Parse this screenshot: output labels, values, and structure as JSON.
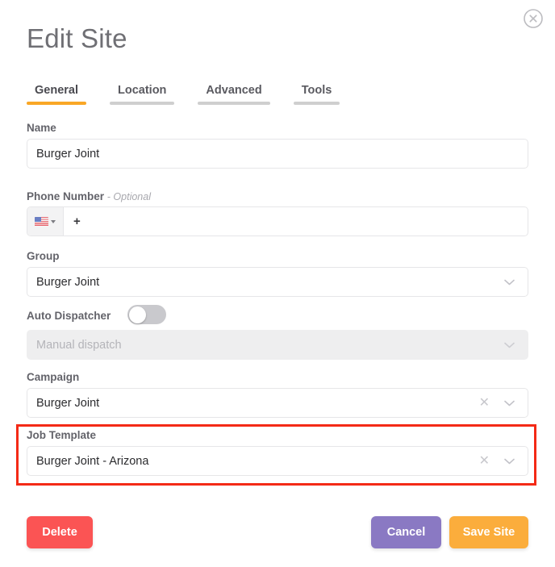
{
  "modal": {
    "title": "Edit Site",
    "close_icon": "close-circle-icon"
  },
  "tabs": [
    {
      "label": "General",
      "active": true
    },
    {
      "label": "Location",
      "active": false
    },
    {
      "label": "Advanced",
      "active": false
    },
    {
      "label": "Tools",
      "active": false
    }
  ],
  "fields": {
    "name": {
      "label": "Name",
      "value": "Burger Joint"
    },
    "phone": {
      "label": "Phone Number",
      "optional_note": "- Optional",
      "country_flag": "us-flag-icon",
      "prefix": "+",
      "value": ""
    },
    "group": {
      "label": "Group",
      "value": "Burger Joint"
    },
    "auto_dispatcher": {
      "label": "Auto Dispatcher",
      "enabled": false,
      "dispatch_mode": "Manual dispatch"
    },
    "campaign": {
      "label": "Campaign",
      "value": "Burger Joint"
    },
    "job_template": {
      "label": "Job Template",
      "value": "Burger Joint - Arizona",
      "highlighted": true
    }
  },
  "footer": {
    "delete_label": "Delete",
    "cancel_label": "Cancel",
    "save_label": "Save Site"
  },
  "colors": {
    "accent_orange": "#f9a726",
    "delete_red": "#fb5454",
    "cancel_purple": "#8a79c3",
    "save_orange": "#fbad3c",
    "highlight_red": "#f42a16",
    "label_grey": "#63636a"
  }
}
